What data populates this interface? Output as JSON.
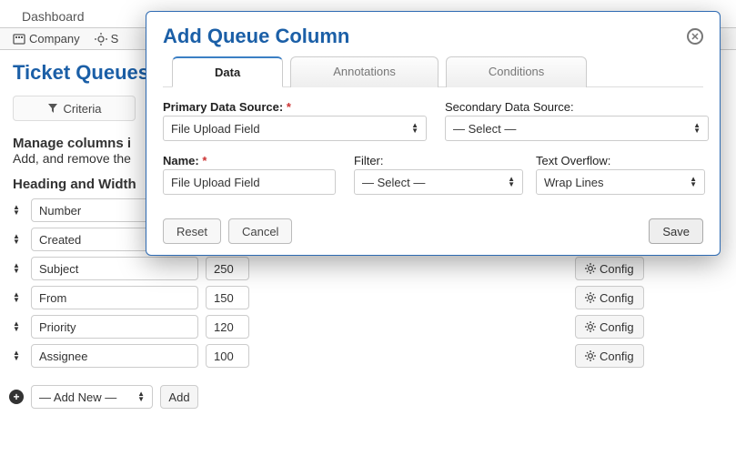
{
  "tabbar": {
    "dashboard": "Dashboard"
  },
  "toolbar": {
    "company": "Company",
    "s_frag": "S"
  },
  "page": {
    "title_fragment": "Ticket Queues "
  },
  "criteria": {
    "label": "Criteria"
  },
  "manage": {
    "line1": "Manage columns i",
    "line2": "Add, and remove the"
  },
  "section": {
    "heading_width": "Heading and Width"
  },
  "columns": [
    {
      "name": "Number",
      "width": ""
    },
    {
      "name": "Created",
      "width": ""
    },
    {
      "name": "Subject",
      "width": "250"
    },
    {
      "name": "From",
      "width": "150"
    },
    {
      "name": "Priority",
      "width": "120"
    },
    {
      "name": "Assignee",
      "width": "100"
    }
  ],
  "config_label": "Config",
  "addnew": {
    "placeholder": "— Add New —",
    "button": "Add"
  },
  "dialog": {
    "title": "Add Queue Column",
    "tabs": {
      "data": "Data",
      "annotations": "Annotations",
      "conditions": "Conditions"
    },
    "primary": {
      "label": "Primary Data Source:",
      "value": "File Upload Field"
    },
    "secondary": {
      "label": "Secondary Data Source:",
      "value": "— Select —"
    },
    "name": {
      "label": "Name:",
      "value": "File Upload Field"
    },
    "filter": {
      "label": "Filter:",
      "value": "— Select —"
    },
    "overflow": {
      "label": "Text Overflow:",
      "value": "Wrap Lines"
    },
    "buttons": {
      "reset": "Reset",
      "cancel": "Cancel",
      "save": "Save"
    }
  }
}
